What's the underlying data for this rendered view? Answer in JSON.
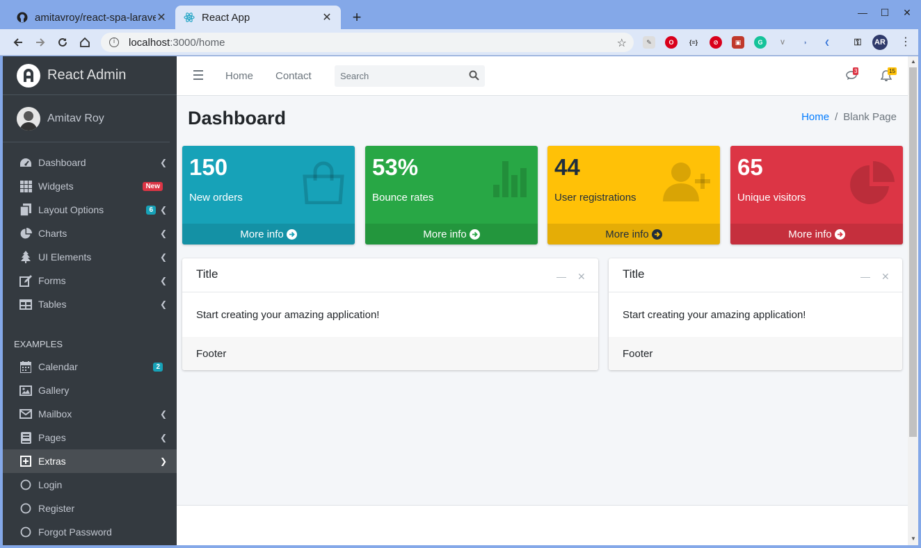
{
  "browser": {
    "tabs": [
      {
        "title": "amitavroy/react-spa-laravel",
        "icon": "github-icon"
      },
      {
        "title": "React App",
        "icon": "react-icon"
      }
    ],
    "url_host": "localhost",
    "url_path": ":3000/home",
    "profile_initials": "AR"
  },
  "sidebar": {
    "brand": "React Admin",
    "user": "Amitav Roy",
    "items": [
      {
        "label": "Dashboard",
        "icon": "tachometer-icon"
      },
      {
        "label": "Widgets",
        "icon": "grid-icon",
        "badge": "New"
      },
      {
        "label": "Layout Options",
        "icon": "copy-icon",
        "badge": "6"
      },
      {
        "label": "Charts",
        "icon": "pie-chart-icon"
      },
      {
        "label": "UI Elements",
        "icon": "tree-icon"
      },
      {
        "label": "Forms",
        "icon": "edit-icon"
      },
      {
        "label": "Tables",
        "icon": "table-icon"
      }
    ],
    "examples_header": "EXAMPLES",
    "examples": [
      {
        "label": "Calendar",
        "icon": "calendar-icon",
        "badge": "2"
      },
      {
        "label": "Gallery",
        "icon": "image-icon"
      },
      {
        "label": "Mailbox",
        "icon": "envelope-icon"
      },
      {
        "label": "Pages",
        "icon": "book-icon"
      },
      {
        "label": "Extras",
        "icon": "plus-square-icon"
      },
      {
        "label": "Login",
        "icon": "circle-icon"
      },
      {
        "label": "Register",
        "icon": "circle-icon"
      },
      {
        "label": "Forgot Password",
        "icon": "circle-icon"
      }
    ]
  },
  "topnav": {
    "home": "Home",
    "contact": "Contact",
    "search_placeholder": "Search",
    "messages_count": "3",
    "notifications_count": "15"
  },
  "page": {
    "title": "Dashboard",
    "breadcrumb_home": "Home",
    "breadcrumb_current": "Blank Page"
  },
  "stats": [
    {
      "value": "150",
      "label": "New orders",
      "footer": "More info",
      "color": "#17a2b8",
      "icon": "shopping-bag-icon"
    },
    {
      "value": "53%",
      "label": "Bounce rates",
      "footer": "More info",
      "color": "#28a745",
      "icon": "bar-chart-icon"
    },
    {
      "value": "44",
      "label": "User registrations",
      "footer": "More info",
      "color": "#ffc107",
      "icon": "user-plus-icon"
    },
    {
      "value": "65",
      "label": "Unique visitors",
      "footer": "More info",
      "color": "#dc3545",
      "icon": "pie-chart-icon"
    }
  ],
  "cards": [
    {
      "title": "Title",
      "body": "Start creating your amazing application!",
      "footer": "Footer"
    },
    {
      "title": "Title",
      "body": "Start creating your amazing application!",
      "footer": "Footer"
    }
  ]
}
